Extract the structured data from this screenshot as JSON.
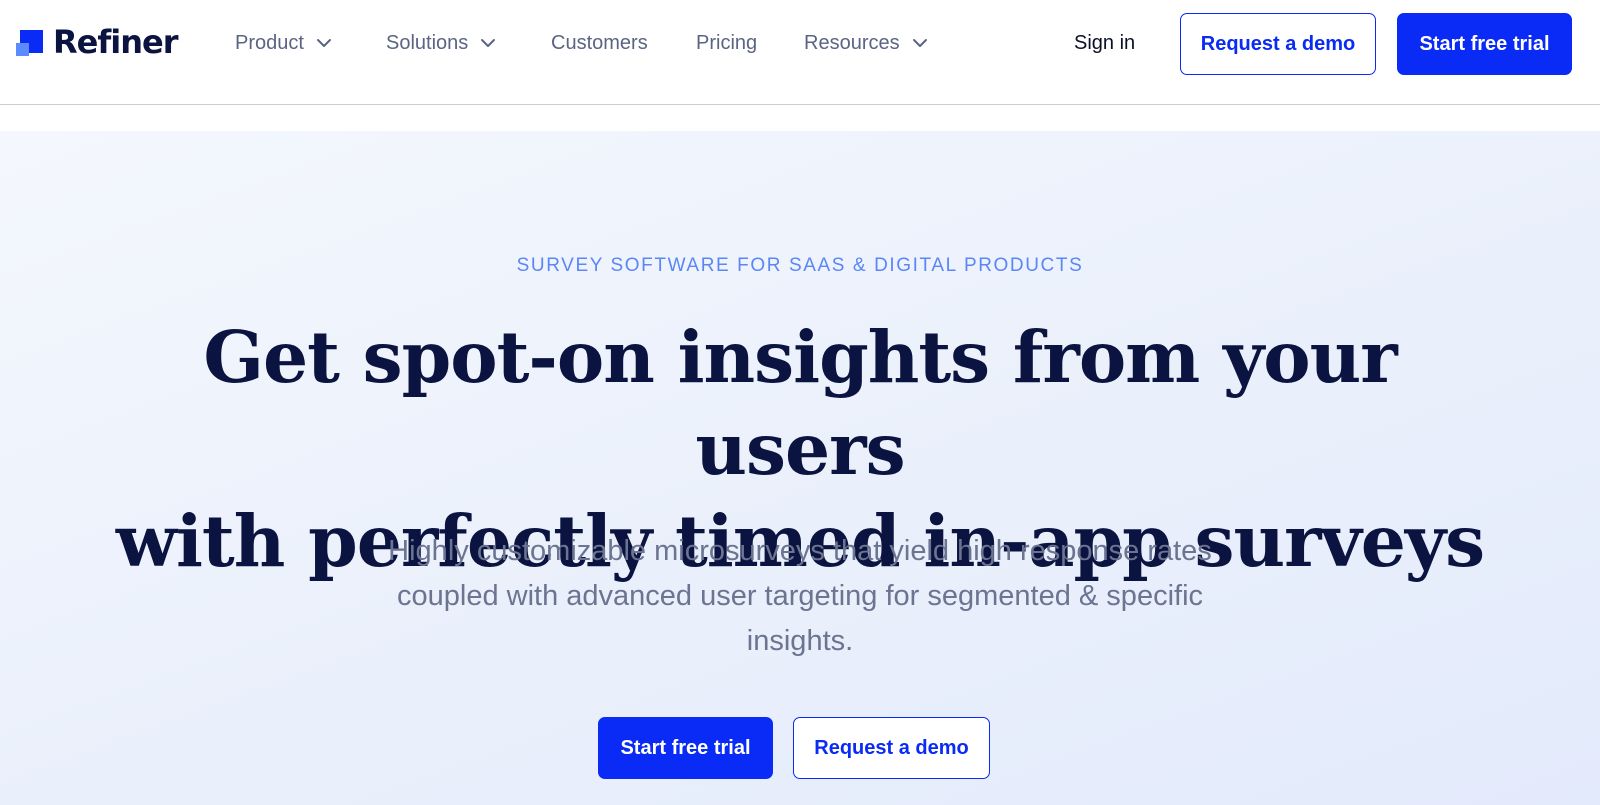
{
  "brand": {
    "name": "Refiner",
    "accent": "#0a2bf5",
    "accent_light": "#5b8bff",
    "ink": "#0b1440"
  },
  "nav": {
    "items": [
      {
        "label": "Product",
        "has_dropdown": true
      },
      {
        "label": "Solutions",
        "has_dropdown": true
      },
      {
        "label": "Customers",
        "has_dropdown": false
      },
      {
        "label": "Pricing",
        "has_dropdown": false
      },
      {
        "label": "Resources",
        "has_dropdown": true
      }
    ],
    "sign_in": "Sign in",
    "request_demo": "Request a demo",
    "start_trial": "Start free trial"
  },
  "hero": {
    "eyebrow": "SURVEY SOFTWARE FOR SAAS & DIGITAL PRODUCTS",
    "headline_line1": "Get spot-on insights from your users",
    "headline_line2": "with perfectly timed in-app surveys",
    "subtext": "Highly customizable microsurveys that yield high response rates coupled with advanced user targeting for segmented & specific insights.",
    "cta_primary": "Start free trial",
    "cta_secondary": "Request a demo"
  },
  "icons": {
    "logo": "refiner-logo-icon",
    "dropdown": "chevron-down-icon"
  }
}
